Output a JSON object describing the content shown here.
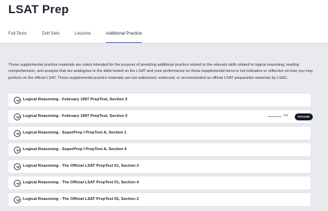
{
  "header": {
    "title": "LSAT Prep"
  },
  "tabs": [
    {
      "label": "Full Tests"
    },
    {
      "label": "Drill Sets"
    },
    {
      "label": "Lessons"
    },
    {
      "label": "Additional Practice"
    }
  ],
  "disclaimer": "These supplemental practice materials are solely intended for the purpose of providing additional practice related to the relevant skills related to logical reasoning, reading comprehension, and analysis that are analogous to the skills tested on the LSAT and your performance on these supplemental items is not indicative or reflective on how you may perform on the official LSAT. These supplemental practice materials are not authorized, endorsed, or recommended as official LSAT preparation materials by LSAC.",
  "items": [
    {
      "label": "Logical Reasoning - February 1997 PrepTest, Section 2"
    },
    {
      "label": "Logical Reasoning - February 1997 PrepTest, Section 3",
      "progress": "0/1",
      "action": "RESUME"
    },
    {
      "label": "Logical Reasoning - SuperPrep I PrepTest A, Section 1"
    },
    {
      "label": "Logical Reasoning - SuperPrep I PrepTest A, Section 4"
    },
    {
      "label": "Logical Reasoning - The Official LSAT PrepTest 01, Section 3"
    },
    {
      "label": "Logical Reasoning - The Official LSAT PrepTest 01, Section 4"
    },
    {
      "label": "Logical Reasoning - The Official LSAT PrepTest 02, Section 2"
    }
  ],
  "colors": {
    "accent": "#3a63d6",
    "background": "#e9eaee",
    "resume_bg": "#121826"
  },
  "icons": {
    "expand": "chevron-down-icon"
  }
}
